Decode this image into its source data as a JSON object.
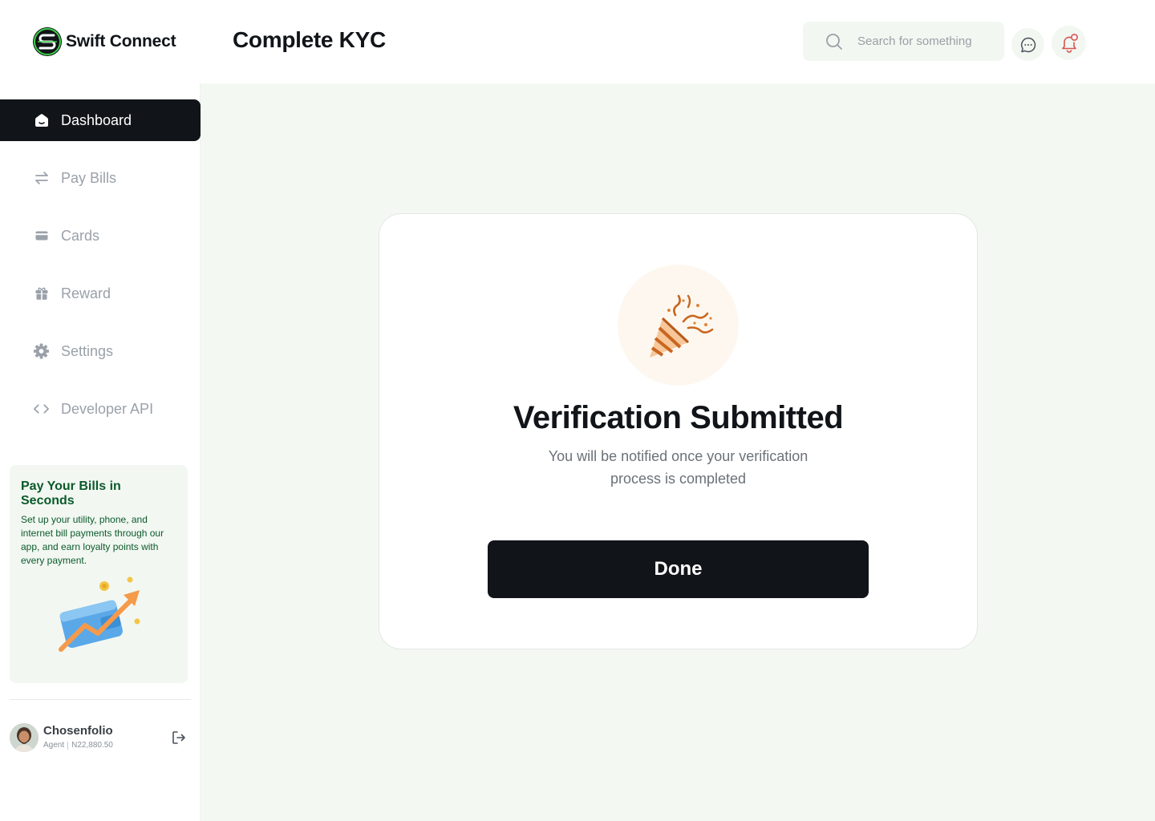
{
  "app": {
    "brand_name": "Swift Connect",
    "page_title": "Complete KYC"
  },
  "header": {
    "search_placeholder": "Search for something",
    "icons": [
      "search-icon",
      "chat-icon",
      "bell-icon"
    ],
    "notification_dot_color": "#e23b3b"
  },
  "sidebar": {
    "items": [
      {
        "label": "Dashboard",
        "icon": "home-icon",
        "active": true
      },
      {
        "label": "Pay Bills",
        "icon": "transfer-arrows-icon",
        "active": false
      },
      {
        "label": "Cards",
        "icon": "card-icon",
        "active": false
      },
      {
        "label": "Reward",
        "icon": "gift-icon",
        "active": false
      },
      {
        "label": "Settings",
        "icon": "gear-icon",
        "active": false
      },
      {
        "label": "Developer API",
        "icon": "code-icon",
        "active": false
      }
    ],
    "promo": {
      "title": "Pay Your Bills in Seconds",
      "text": "Set up your utility, phone, and internet bill payments through our app, and earn loyalty points with every payment."
    },
    "user": {
      "name": "Chosenfolio",
      "role": "Agent",
      "balance": "N22,880.50"
    }
  },
  "modal": {
    "icon": "party-popper-icon",
    "title": "Verification Submitted",
    "subtitle": "You will be notified once your verification process is completed",
    "button_label": "Done"
  },
  "colors": {
    "accent": "#111418",
    "brand_green": "#0b5a2a",
    "main_bg": "#f4f8f3"
  }
}
